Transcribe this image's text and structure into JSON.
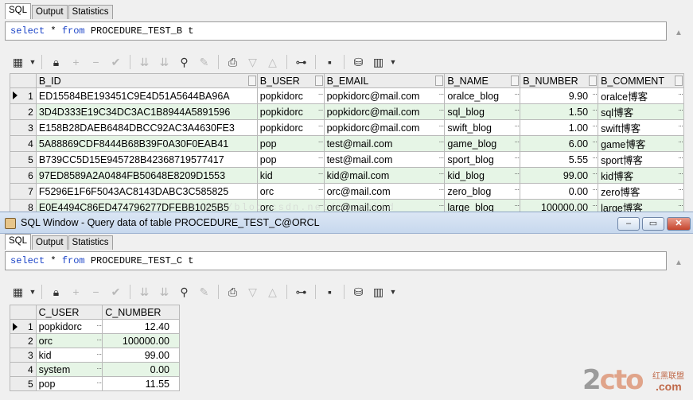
{
  "top_pane": {
    "tabs": [
      "SQL",
      "Output",
      "Statistics"
    ],
    "sql_keyword_1": "select",
    "sql_star": " * ",
    "sql_keyword_2": "from",
    "sql_rest": " PROCEDURE_TEST_B t",
    "columns": [
      "B_ID",
      "B_USER",
      "B_EMAIL",
      "B_NAME",
      "B_NUMBER",
      "B_COMMENT"
    ],
    "rows": [
      {
        "n": "1",
        "id": "ED15584BE193451C9E4D51A5644BA96A",
        "user": "popkidorc",
        "email": "popkidorc@mail.com",
        "name": "oralce_blog",
        "number": "9.90",
        "comment": "oralce博客"
      },
      {
        "n": "2",
        "id": "3D4D333E19C34DC3AC1B8944A5891596",
        "user": "popkidorc",
        "email": "popkidorc@mail.com",
        "name": "sql_blog",
        "number": "1.50",
        "comment": "sql博客"
      },
      {
        "n": "3",
        "id": "E158B28DAEB6484DBCC92AC3A4630FE3",
        "user": "popkidorc",
        "email": "popkidorc@mail.com",
        "name": "swift_blog",
        "number": "1.00",
        "comment": "swift博客"
      },
      {
        "n": "4",
        "id": "5A88869CDF8444B68B39F0A30F0EAB41",
        "user": "pop",
        "email": "test@mail.com",
        "name": "game_blog",
        "number": "6.00",
        "comment": "game博客"
      },
      {
        "n": "5",
        "id": "B739CC5D15E945728B42368719577417",
        "user": "pop",
        "email": "test@mail.com",
        "name": "sport_blog",
        "number": "5.55",
        "comment": "sport博客"
      },
      {
        "n": "6",
        "id": "97ED8589A2A0484FB50648E8209D1553",
        "user": "kid",
        "email": "kid@mail.com",
        "name": "kid_blog",
        "number": "99.00",
        "comment": "kid博客"
      },
      {
        "n": "7",
        "id": "F5296E1F6F5043AC8143DABC3C585825",
        "user": "orc",
        "email": "orc@mail.com",
        "name": "zero_blog",
        "number": "0.00",
        "comment": "zero博客"
      },
      {
        "n": "8",
        "id": "E0E4494C86ED474796277DFEBB1025B5",
        "user": "orc",
        "email": "orc@mail.com",
        "name": "large_blog",
        "number": "100000.00",
        "comment": "large博客"
      }
    ]
  },
  "window": {
    "title": "SQL Window - Query data of table PROCEDURE_TEST_C@ORCL",
    "minimize": "–",
    "restore": "▭",
    "close": "✕"
  },
  "bottom_pane": {
    "tabs": [
      "SQL",
      "Output",
      "Statistics"
    ],
    "sql_keyword_1": "select",
    "sql_star": " * ",
    "sql_keyword_2": "from",
    "sql_rest": " PROCEDURE_TEST_C t",
    "columns": [
      "C_USER",
      "C_NUMBER"
    ],
    "rows": [
      {
        "n": "1",
        "user": "popkidorc",
        "number": "12.40"
      },
      {
        "n": "2",
        "user": "orc",
        "number": "100000.00"
      },
      {
        "n": "3",
        "user": "kid",
        "number": "99.00"
      },
      {
        "n": "4",
        "user": "system",
        "number": "0.00"
      },
      {
        "n": "5",
        "user": "pop",
        "number": "11.55"
      }
    ]
  },
  "watermark": "http://blog.csdn.net/popppkid",
  "logo": {
    "main_a": "2",
    "main_b": "cto",
    "small": "红黑联盟",
    "dot_com": ".com"
  },
  "colors": {
    "keyword": "#1e46c8",
    "row_alt": "#e6f5e6",
    "title_bar": "#c7d8ee"
  },
  "icons": {
    "scroll_up": "▲",
    "cell_dots": "···",
    "toolbar": [
      "grid-icon",
      "lock-icon",
      "plus-icon",
      "minus-icon",
      "check-icon",
      "down-arrows-icon",
      "down-arrows-2-icon",
      "binoculars-icon",
      "eraser-icon",
      "print-icon",
      "filter-down-icon",
      "filter-up-icon",
      "tree-icon",
      "save-icon",
      "db-icon",
      "chart-icon"
    ]
  }
}
